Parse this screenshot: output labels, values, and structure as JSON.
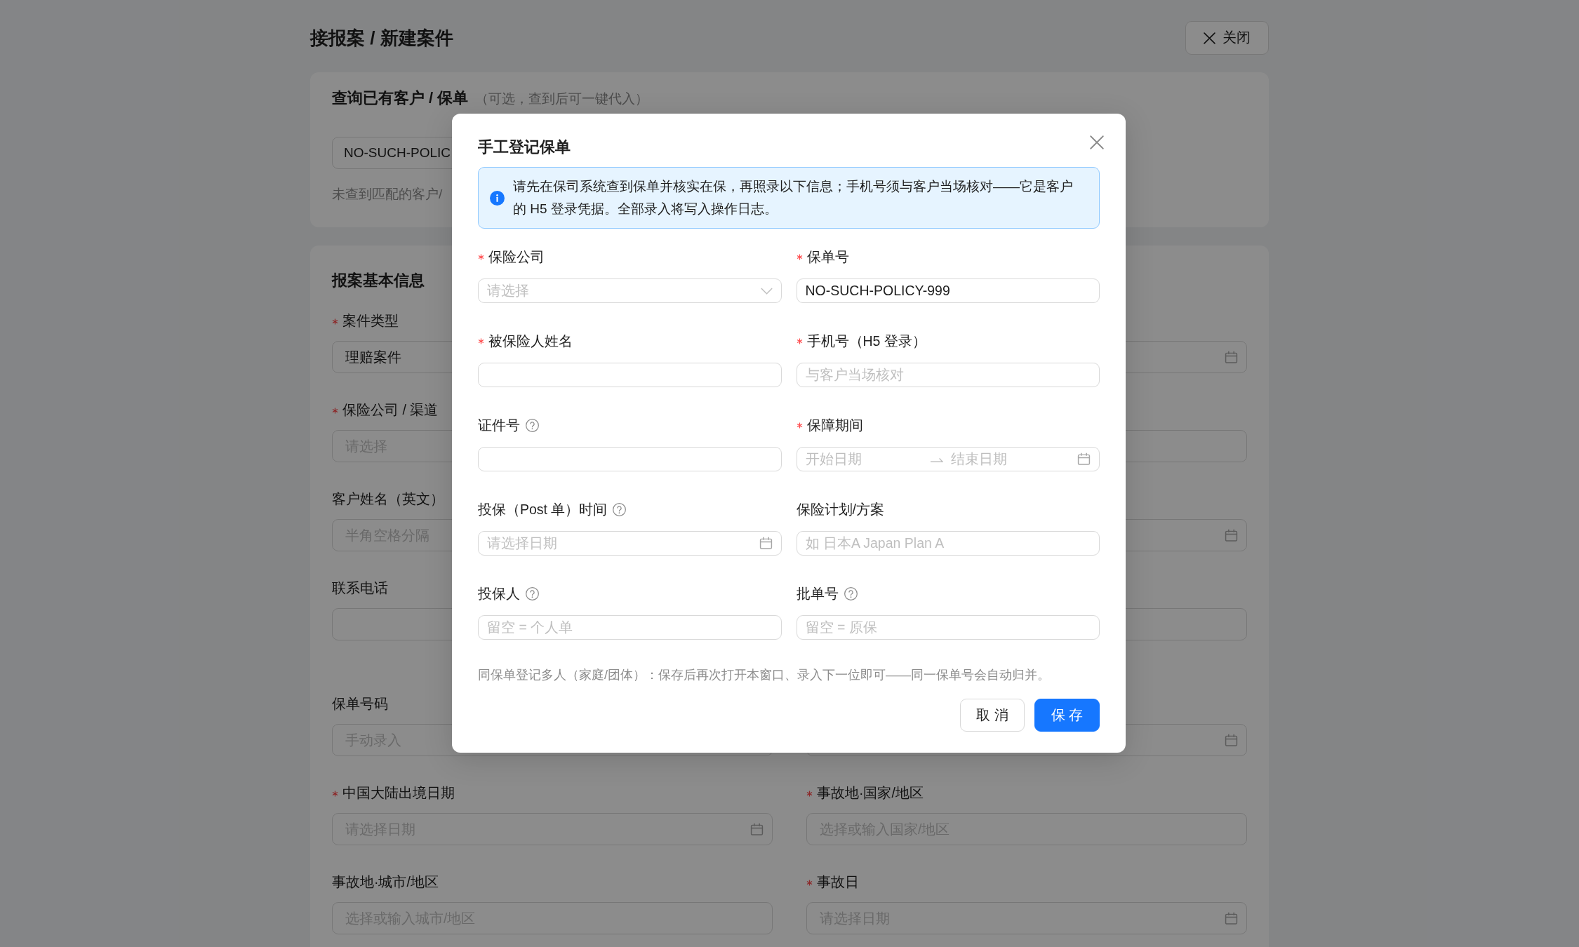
{
  "page": {
    "title": "接报案 / 新建案件",
    "close_button": "关闭"
  },
  "query_card": {
    "title": "查询已有客户 / 保单",
    "subtitle": "（可选，查到后可一键代入）",
    "search_field": {
      "value": "NO-SUCH-POLIC"
    },
    "message": "未查到匹配的客户/"
  },
  "case_card": {
    "title": "报案基本信息",
    "rows": [
      {
        "left": {
          "kind": "input",
          "label": "案件类型",
          "required": true,
          "value": "理赔案件"
        },
        "right": {
          "kind": "date"
        }
      },
      {
        "left": {
          "kind": "input",
          "label": "保险公司 / 渠道",
          "required": true,
          "placeholder": "请选择"
        },
        "right": {
          "kind": "input"
        }
      },
      {
        "left": {
          "kind": "input",
          "label": "客户姓名（英文）",
          "required": false,
          "placeholder": "半角空格分隔"
        },
        "right": {
          "kind": "date"
        }
      },
      {
        "left": {
          "kind": "input",
          "label": "联系电话",
          "required": false
        },
        "right": {
          "kind": "input"
        }
      },
      {
        "left": {
          "kind": "input",
          "label": "保单号码",
          "required": false,
          "placeholder": "手动录入"
        },
        "right": {
          "kind": "date"
        }
      },
      {
        "left": {
          "kind": "date",
          "label": "中国大陆出境日期",
          "required": true,
          "placeholder": "请选择日期"
        },
        "right": {
          "kind": "input",
          "label": "事故地·国家/地区",
          "required": true,
          "placeholder": "选择或输入国家/地区"
        }
      },
      {
        "left": {
          "kind": "input",
          "label": "事故地·城市/地区",
          "required": false,
          "placeholder": "选择或输入城市/地区"
        },
        "right": {
          "kind": "date",
          "label": "事故日",
          "required": true,
          "placeholder": "请选择日期"
        }
      }
    ]
  },
  "modal": {
    "title": "手工登记保单",
    "alert": "请先在保司系统查到保单并核实在保，再照录以下信息；手机号须与客户当场核对——它是客户的 H5 登录凭据。全部录入将写入操作日志。",
    "fields": [
      {
        "kind": "select",
        "label": "保险公司",
        "required": true,
        "help": false,
        "placeholder": "请选择"
      },
      {
        "kind": "input",
        "label": "保单号",
        "required": true,
        "help": false,
        "value": "NO-SUCH-POLICY-999"
      },
      {
        "kind": "input",
        "label": "被保险人姓名",
        "required": true,
        "help": false
      },
      {
        "kind": "input",
        "label": "手机号（H5 登录）",
        "required": true,
        "help": false,
        "placeholder": "与客户当场核对"
      },
      {
        "kind": "input",
        "label": "证件号",
        "required": false,
        "help": true
      },
      {
        "kind": "date_range",
        "label": "保障期间",
        "required": true,
        "help": false,
        "start_placeholder": "开始日期",
        "end_placeholder": "结束日期"
      },
      {
        "kind": "date",
        "label": "投保（Post 单）时间",
        "required": false,
        "help": true,
        "placeholder": "请选择日期"
      },
      {
        "kind": "input",
        "label": "保险计划/方案",
        "required": false,
        "help": false,
        "placeholder": "如 日本A Japan Plan A"
      },
      {
        "kind": "input",
        "label": "投保人",
        "required": false,
        "help": true,
        "placeholder": "留空 = 个人单"
      },
      {
        "kind": "input",
        "label": "批单号",
        "required": false,
        "help": true,
        "placeholder": "留空 = 原保"
      }
    ],
    "note": "同保单登记多人（家庭/团体）：保存后再次打开本窗口、录入下一位即可——同一保单号会自动归并。",
    "buttons": [
      {
        "label": "取 消",
        "kind": "default"
      },
      {
        "label": "保 存",
        "kind": "primary"
      }
    ]
  }
}
